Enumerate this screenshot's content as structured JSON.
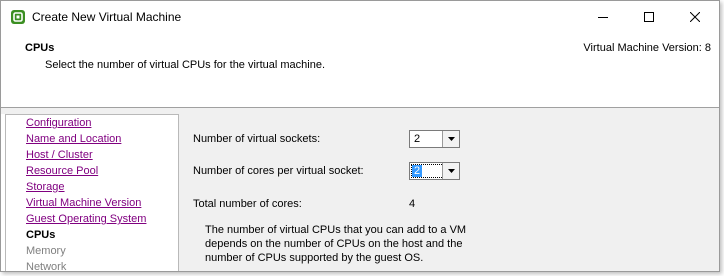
{
  "window": {
    "title": "Create New Virtual Machine",
    "controls": {
      "minimize_icon": "minimize-icon",
      "maximize_icon": "maximize-icon",
      "close_icon": "close-icon"
    }
  },
  "header": {
    "title": "CPUs",
    "subtitle": "Select the number of virtual CPUs for the virtual machine.",
    "version": "Virtual Machine Version: 8"
  },
  "sidebar": {
    "items": [
      {
        "label": "Configuration",
        "state": "visited"
      },
      {
        "label": "Name and Location",
        "state": "visited"
      },
      {
        "label": "Host / Cluster",
        "state": "visited"
      },
      {
        "label": "Resource Pool",
        "state": "visited"
      },
      {
        "label": "Storage",
        "state": "visited"
      },
      {
        "label": "Virtual Machine Version",
        "state": "visited"
      },
      {
        "label": "Guest Operating System",
        "state": "visited"
      },
      {
        "label": "CPUs",
        "state": "current"
      },
      {
        "label": "Memory",
        "state": "future"
      },
      {
        "label": "Network",
        "state": "future"
      }
    ]
  },
  "form": {
    "sockets_label": "Number of virtual sockets:",
    "sockets_value": "2",
    "cores_label": "Number of cores per virtual socket:",
    "cores_value": "2",
    "total_label": "Total number of cores:",
    "total_value": "4",
    "info": "The number of virtual CPUs that you can add to a VM depends on the number of CPUs on the host and the number of CPUs supported by the guest OS."
  },
  "colors": {
    "link_visited": "#800080",
    "selection": "#3399ff",
    "panel_bg": "#f0f0f0"
  }
}
